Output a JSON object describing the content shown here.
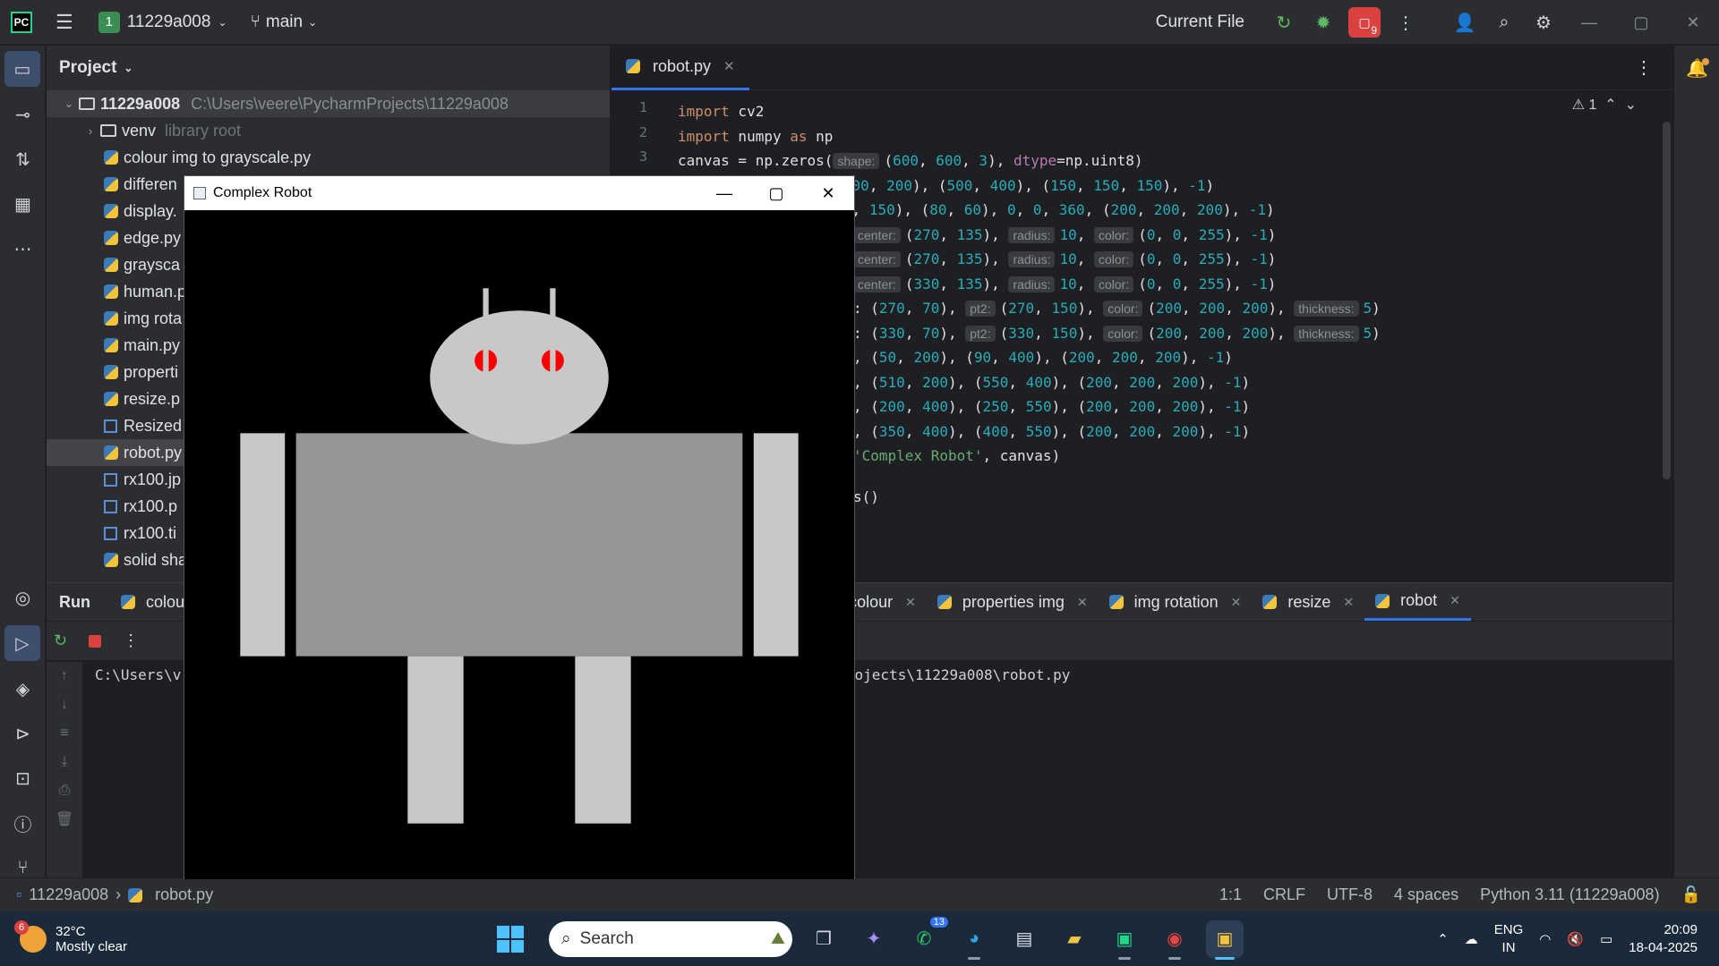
{
  "titlebar": {
    "project_badge": "1",
    "project_name": "11229a008",
    "branch": "main",
    "run_config": "Current File",
    "stop_count": "9"
  },
  "project_panel": {
    "title": "Project",
    "root": {
      "name": "11229a008",
      "path": "C:\\Users\\veere\\PycharmProjects\\11229a008"
    },
    "venv": {
      "name": "venv",
      "note": "library root"
    },
    "files": [
      {
        "name": "colour img to grayscale.py",
        "icon": "python"
      },
      {
        "name": "differen",
        "icon": "python"
      },
      {
        "name": "display.",
        "icon": "python"
      },
      {
        "name": "edge.py",
        "icon": "python"
      },
      {
        "name": "graysca",
        "icon": "python"
      },
      {
        "name": "human.p",
        "icon": "python"
      },
      {
        "name": "img rota",
        "icon": "python"
      },
      {
        "name": "main.py",
        "icon": "python"
      },
      {
        "name": "properti",
        "icon": "python"
      },
      {
        "name": "resize.p",
        "icon": "python"
      },
      {
        "name": "Resized",
        "icon": "image"
      },
      {
        "name": "robot.py",
        "icon": "python"
      },
      {
        "name": "rx100.jp",
        "icon": "image"
      },
      {
        "name": "rx100.p",
        "icon": "image"
      },
      {
        "name": "rx100.ti",
        "icon": "image"
      },
      {
        "name": "solid sha",
        "icon": "python"
      }
    ]
  },
  "editor": {
    "tab": "robot.py",
    "warnings": "1",
    "line_numbers": [
      "1",
      "2",
      "3"
    ],
    "lines": {
      "l1": [
        "import",
        " cv2"
      ],
      "l2": [
        "import",
        " numpy ",
        "as",
        " np"
      ],
      "l3": [
        "canvas = np.zeros(",
        "shape:",
        "(",
        "600",
        ", ",
        "600",
        ", ",
        "3",
        "), ",
        "dtype",
        "=np.uint8)"
      ],
      "l4": [
        ", (",
        "100",
        ", ",
        "200",
        "), (",
        "500",
        ", ",
        "400",
        "), (",
        "150",
        ", ",
        "150",
        ", ",
        "150",
        "), ",
        "-1",
        ")"
      ],
      "l5": [
        "(",
        "300",
        ", ",
        "150",
        "), (",
        "80",
        ", ",
        "60",
        "), ",
        "0",
        ", ",
        "0",
        ", ",
        "360",
        ", (",
        "200",
        ", ",
        "200",
        ", ",
        "200",
        "), ",
        "-1",
        ")"
      ],
      "l6": [
        "center:",
        "(",
        "270",
        ", ",
        "135",
        "), ",
        "radius:",
        "10",
        ", ",
        "color:",
        "(",
        "0",
        ", ",
        "0",
        ", ",
        "255",
        "), ",
        "-1",
        ")"
      ],
      "l7": [
        "center:",
        "(",
        "270",
        ", ",
        "135",
        "), ",
        "radius:",
        "10",
        ", ",
        "color:",
        "(",
        "0",
        ", ",
        "0",
        ", ",
        "255",
        "), ",
        "-1",
        ")"
      ],
      "l8": [
        "center:",
        "(",
        "330",
        ", ",
        "135",
        "), ",
        "radius:",
        "10",
        ", ",
        "color:",
        "(",
        "0",
        ", ",
        "0",
        ", ",
        "255",
        "), ",
        "-1",
        ")"
      ],
      "l9": [
        ": (",
        "270",
        ", ",
        "70",
        "), ",
        "pt2:",
        "(",
        "270",
        ", ",
        "150",
        "), ",
        "color:",
        "(",
        "200",
        ", ",
        "200",
        ", ",
        "200",
        "), ",
        "thickness:",
        "5",
        ")"
      ],
      "l10": [
        ": (",
        "330",
        ", ",
        "70",
        "), ",
        "pt2:",
        "(",
        "330",
        ", ",
        "150",
        "), ",
        "color:",
        "(",
        "200",
        ", ",
        "200",
        ", ",
        "200",
        "), ",
        "thickness:",
        "5",
        ")"
      ],
      "l11": [
        ", (",
        "50",
        ", ",
        "200",
        "), (",
        "90",
        ", ",
        "400",
        "), (",
        "200",
        ", ",
        "200",
        ", ",
        "200",
        "), ",
        "-1",
        ")"
      ],
      "l12": [
        ", (",
        "510",
        ", ",
        "200",
        "), (",
        "550",
        ", ",
        "400",
        "), (",
        "200",
        ", ",
        "200",
        ", ",
        "200",
        "), ",
        "-1",
        ")"
      ],
      "l13": [
        ", (",
        "200",
        ", ",
        "400",
        "), (",
        "250",
        ", ",
        "550",
        "), (",
        "200",
        ", ",
        "200",
        ", ",
        "200",
        "), ",
        "-1",
        ")"
      ],
      "l14": [
        ", (",
        "350",
        ", ",
        "400",
        "), (",
        "400",
        ", ",
        "550",
        "), (",
        "200",
        ", ",
        "200",
        ", ",
        "200",
        "), ",
        "-1",
        ")"
      ],
      "l15": [
        "'Complex Robot'",
        ", canvas)"
      ],
      "l16": [
        "s()"
      ]
    }
  },
  "run_panel": {
    "title": "Run",
    "tabs": [
      {
        "label": "colou",
        "active": false
      },
      {
        "label": "cale to colour",
        "active": false
      },
      {
        "label": "properties img",
        "active": false
      },
      {
        "label": "img rotation",
        "active": false
      },
      {
        "label": "resize",
        "active": false
      },
      {
        "label": "robot",
        "active": true
      }
    ],
    "console_left": "C:\\Users\\v",
    "console_right": "rmProjects\\11229a008\\robot.py"
  },
  "statusbar": {
    "crumb_project": "11229a008",
    "crumb_file": "robot.py",
    "position": "1:1",
    "line_sep": "CRLF",
    "encoding": "UTF-8",
    "indent": "4 spaces",
    "interpreter": "Python 3.11 (11229a008)"
  },
  "cv_window": {
    "title": "Complex Robot",
    "canvas_size": 600,
    "background": "#000000",
    "shapes": [
      {
        "kind": "rect",
        "p1": [
          100,
          200
        ],
        "p2": [
          500,
          400
        ],
        "color": "#969696"
      },
      {
        "kind": "ellipse",
        "center": [
          300,
          150
        ],
        "axes": [
          80,
          60
        ],
        "color": "#c8c8c8"
      },
      {
        "kind": "circle",
        "center": [
          270,
          135
        ],
        "r": 10,
        "color": "#ff0000"
      },
      {
        "kind": "circle",
        "center": [
          330,
          135
        ],
        "r": 10,
        "color": "#ff0000"
      },
      {
        "kind": "line",
        "p1": [
          270,
          70
        ],
        "p2": [
          270,
          150
        ],
        "w": 5,
        "color": "#c8c8c8"
      },
      {
        "kind": "line",
        "p1": [
          330,
          70
        ],
        "p2": [
          330,
          150
        ],
        "w": 5,
        "color": "#c8c8c8"
      },
      {
        "kind": "rect",
        "p1": [
          50,
          200
        ],
        "p2": [
          90,
          400
        ],
        "color": "#c8c8c8"
      },
      {
        "kind": "rect",
        "p1": [
          510,
          200
        ],
        "p2": [
          550,
          400
        ],
        "color": "#c8c8c8"
      },
      {
        "kind": "rect",
        "p1": [
          200,
          400
        ],
        "p2": [
          250,
          550
        ],
        "color": "#c8c8c8"
      },
      {
        "kind": "rect",
        "p1": [
          350,
          400
        ],
        "p2": [
          400,
          550
        ],
        "color": "#c8c8c8"
      }
    ]
  },
  "taskbar": {
    "weather_temp": "32°C",
    "weather_desc": "Mostly clear",
    "weather_badge": "6",
    "search_placeholder": "Search",
    "whatsapp_badge": "13",
    "lang_top": "ENG",
    "lang_bottom": "IN",
    "time": "20:09",
    "date": "18-04-2025"
  }
}
